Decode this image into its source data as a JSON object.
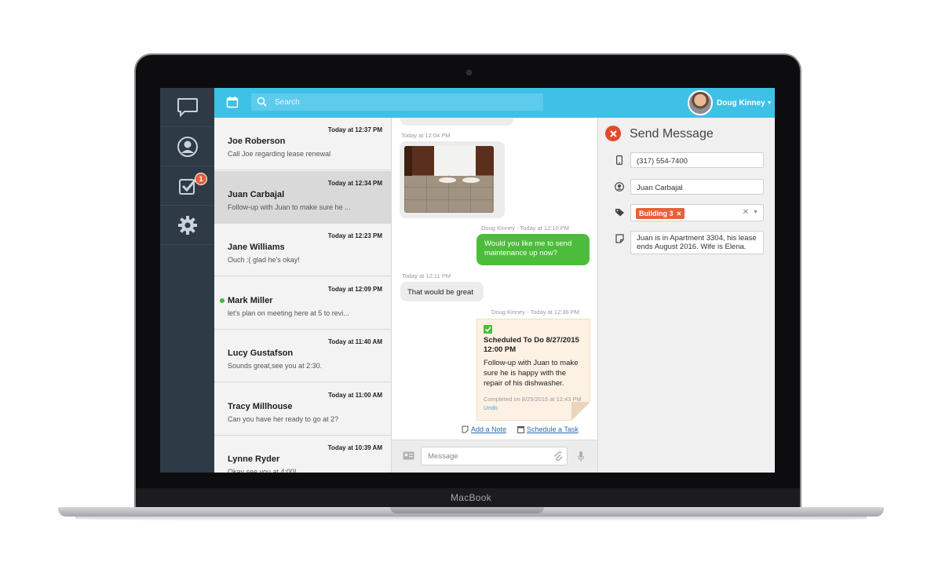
{
  "device": {
    "brand": "MacBook"
  },
  "topbar": {
    "search_placeholder": "Search",
    "user_name": "Doug Kinney"
  },
  "rail": {
    "tasks_badge": "1"
  },
  "conversations": [
    {
      "time": "Today at 12:37 PM",
      "name": "Joe Roberson",
      "preview": "Call Joe regarding lease renewal",
      "active": false,
      "online": false
    },
    {
      "time": "Today at 12:34 PM",
      "name": "Juan Carbajal",
      "preview": "Follow-up with Juan to make sure he ...",
      "active": true,
      "online": false
    },
    {
      "time": "Today at 12:23 PM",
      "name": "Jane Williams",
      "preview": "Ouch :( glad he's okay!",
      "active": false,
      "online": false
    },
    {
      "time": "Today at 12:09 PM",
      "name": "Mark Miller",
      "preview": "let's plan on meeting here at 5 to revi...",
      "active": false,
      "online": true
    },
    {
      "time": "Today at 11:40 AM",
      "name": "Lucy Gustafson",
      "preview": "Sounds great,see you at 2:30.",
      "active": false,
      "online": false
    },
    {
      "time": "Today at 11:00 AM",
      "name": "Tracy Millhouse",
      "preview": "Can you have her ready to go at 2?",
      "active": false,
      "online": false
    },
    {
      "time": "Today at 10:39 AM",
      "name": "Lynne Ryder",
      "preview": "Okay see you at 4:00!",
      "active": false,
      "online": false
    }
  ],
  "chat": {
    "ts_photo": "Today at 12:04 PM",
    "ts_out": "Doug Kinney - Today at 12:10 PM",
    "msg_out": "Would you like me to send maintenance up now?",
    "ts_in": "Today at 12:11 PM",
    "msg_in": "That would be great",
    "ts_task": "Doug Kinney - Today at 12:36 PM",
    "task_title": "Scheduled To Do 8/27/2015 12:00 PM",
    "task_body": "Follow-up with Juan to make sure he is happy with the repair of his dishwasher.",
    "task_completed": "Completed on 8/25/2015 at 12:43 PM",
    "task_undo": "Undo",
    "add_note": "Add a Note",
    "schedule_task": "Schedule a Task",
    "message_placeholder": "Message"
  },
  "panel": {
    "title": "Send Message",
    "phone": "(317) 554-7400",
    "contact": "Juan Carbajal",
    "tag": "Building 3",
    "note": "Juan is in Apartment 3304, his lease ends August 2016.  Wife is Elena."
  },
  "colors": {
    "accent": "#3fc0e7",
    "rail": "#2e3a45",
    "sent": "#4cbd3a",
    "tag": "#e8603c",
    "close": "#e3492b"
  }
}
